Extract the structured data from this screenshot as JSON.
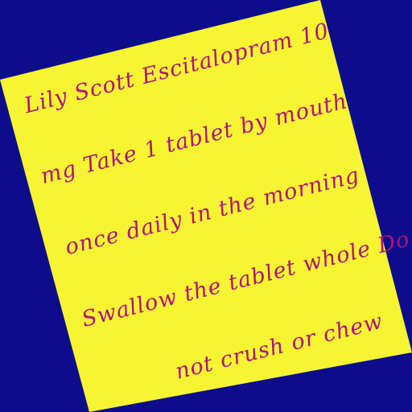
{
  "colors": {
    "background": "#0d0d8c",
    "paper": "#f7f531",
    "ink": "#b0127a"
  },
  "note": {
    "lines": [
      "Lily Scott Escitalopram 10",
      "mg Take 1 tablet by mouth",
      "once daily in the morning",
      "Swallow the tablet whole Do",
      "not crush or chew"
    ]
  }
}
